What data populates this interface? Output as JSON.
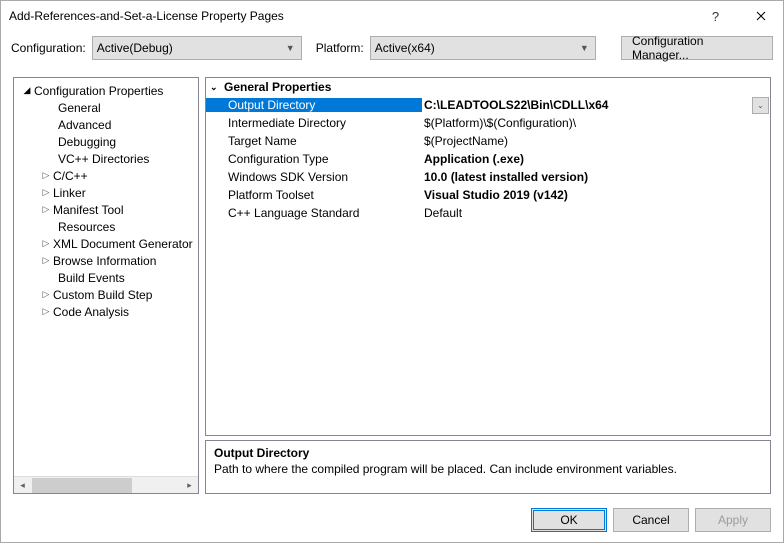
{
  "title": "Add-References-and-Set-a-License Property Pages",
  "configrow": {
    "configuration_label": "Configuration:",
    "configuration_value": "Active(Debug)",
    "platform_label": "Platform:",
    "platform_value": "Active(x64)",
    "manager_button": "Configuration Manager..."
  },
  "tree": {
    "root": "Configuration Properties",
    "items": [
      "General",
      "Advanced",
      "Debugging",
      "VC++ Directories",
      "C/C++",
      "Linker",
      "Manifest Tool",
      "Resources",
      "XML Document Generator",
      "Browse Information",
      "Build Events",
      "Custom Build Step",
      "Code Analysis"
    ]
  },
  "properties": {
    "header": "General Properties",
    "rows": [
      {
        "label": "Output Directory",
        "value": "C:\\LEADTOOLS22\\Bin\\CDLL\\x64",
        "selected": true,
        "bold": true
      },
      {
        "label": "Intermediate Directory",
        "value": "$(Platform)\\$(Configuration)\\",
        "bold": false
      },
      {
        "label": "Target Name",
        "value": "$(ProjectName)",
        "bold": false
      },
      {
        "label": "Configuration Type",
        "value": "Application (.exe)",
        "bold": true
      },
      {
        "label": "Windows SDK Version",
        "value": "10.0 (latest installed version)",
        "bold": true
      },
      {
        "label": "Platform Toolset",
        "value": "Visual Studio 2019 (v142)",
        "bold": true
      },
      {
        "label": "C++ Language Standard",
        "value": "Default",
        "bold": false
      }
    ]
  },
  "description": {
    "title": "Output Directory",
    "text": "Path to where the compiled program will be placed. Can include environment variables."
  },
  "buttons": {
    "ok": "OK",
    "cancel": "Cancel",
    "apply": "Apply"
  }
}
